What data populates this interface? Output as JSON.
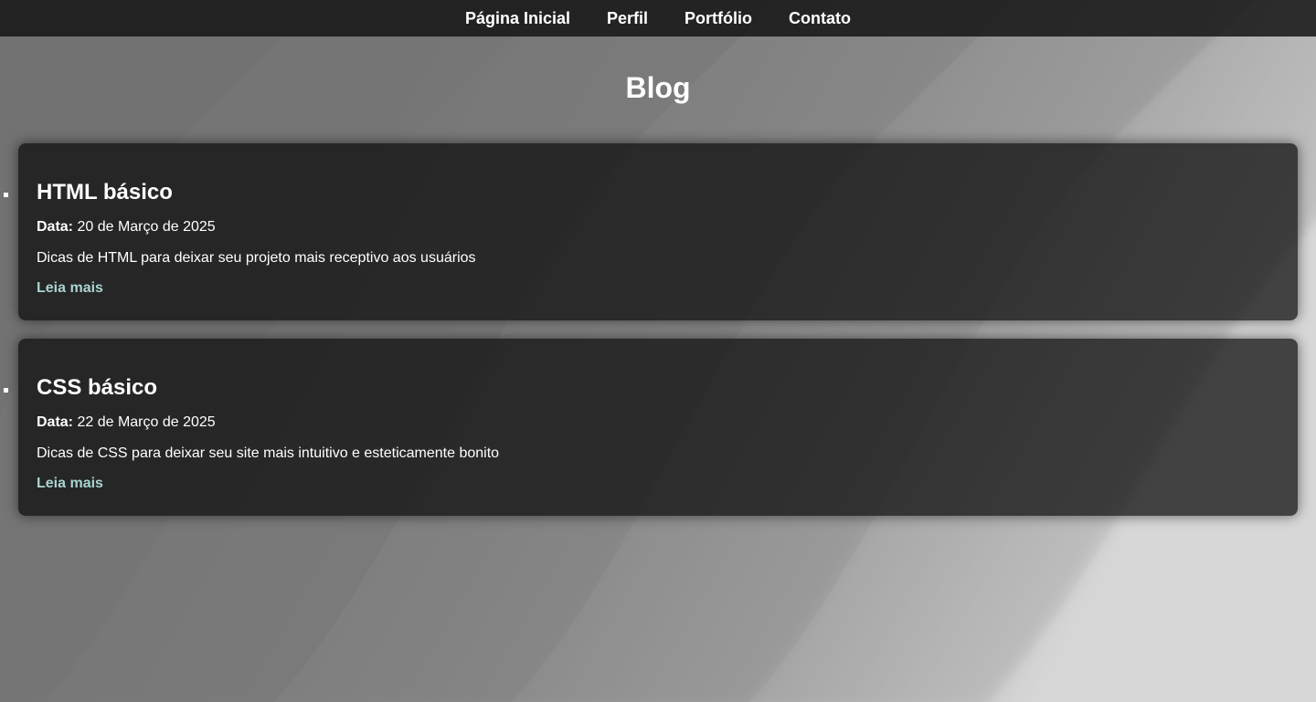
{
  "nav": {
    "items": [
      "Página Inicial",
      "Perfil",
      "Portfólio",
      "Contato"
    ]
  },
  "page": {
    "title": "Blog"
  },
  "posts": [
    {
      "title": "HTML básico",
      "date_label": "Data:",
      "date": "20 de Março de 2025",
      "summary": "Dicas de HTML para deixar seu projeto mais receptivo aos usuários",
      "link": "Leia mais"
    },
    {
      "title": "CSS básico",
      "date_label": "Data:",
      "date": "22 de Março de 2025",
      "summary": "Dicas de CSS para deixar seu site mais intuitivo e esteticamente bonito",
      "link": "Leia mais"
    }
  ],
  "colors": {
    "link": "#a9d4d1",
    "nav_bg": "#141414",
    "card_bg": "#080808"
  }
}
